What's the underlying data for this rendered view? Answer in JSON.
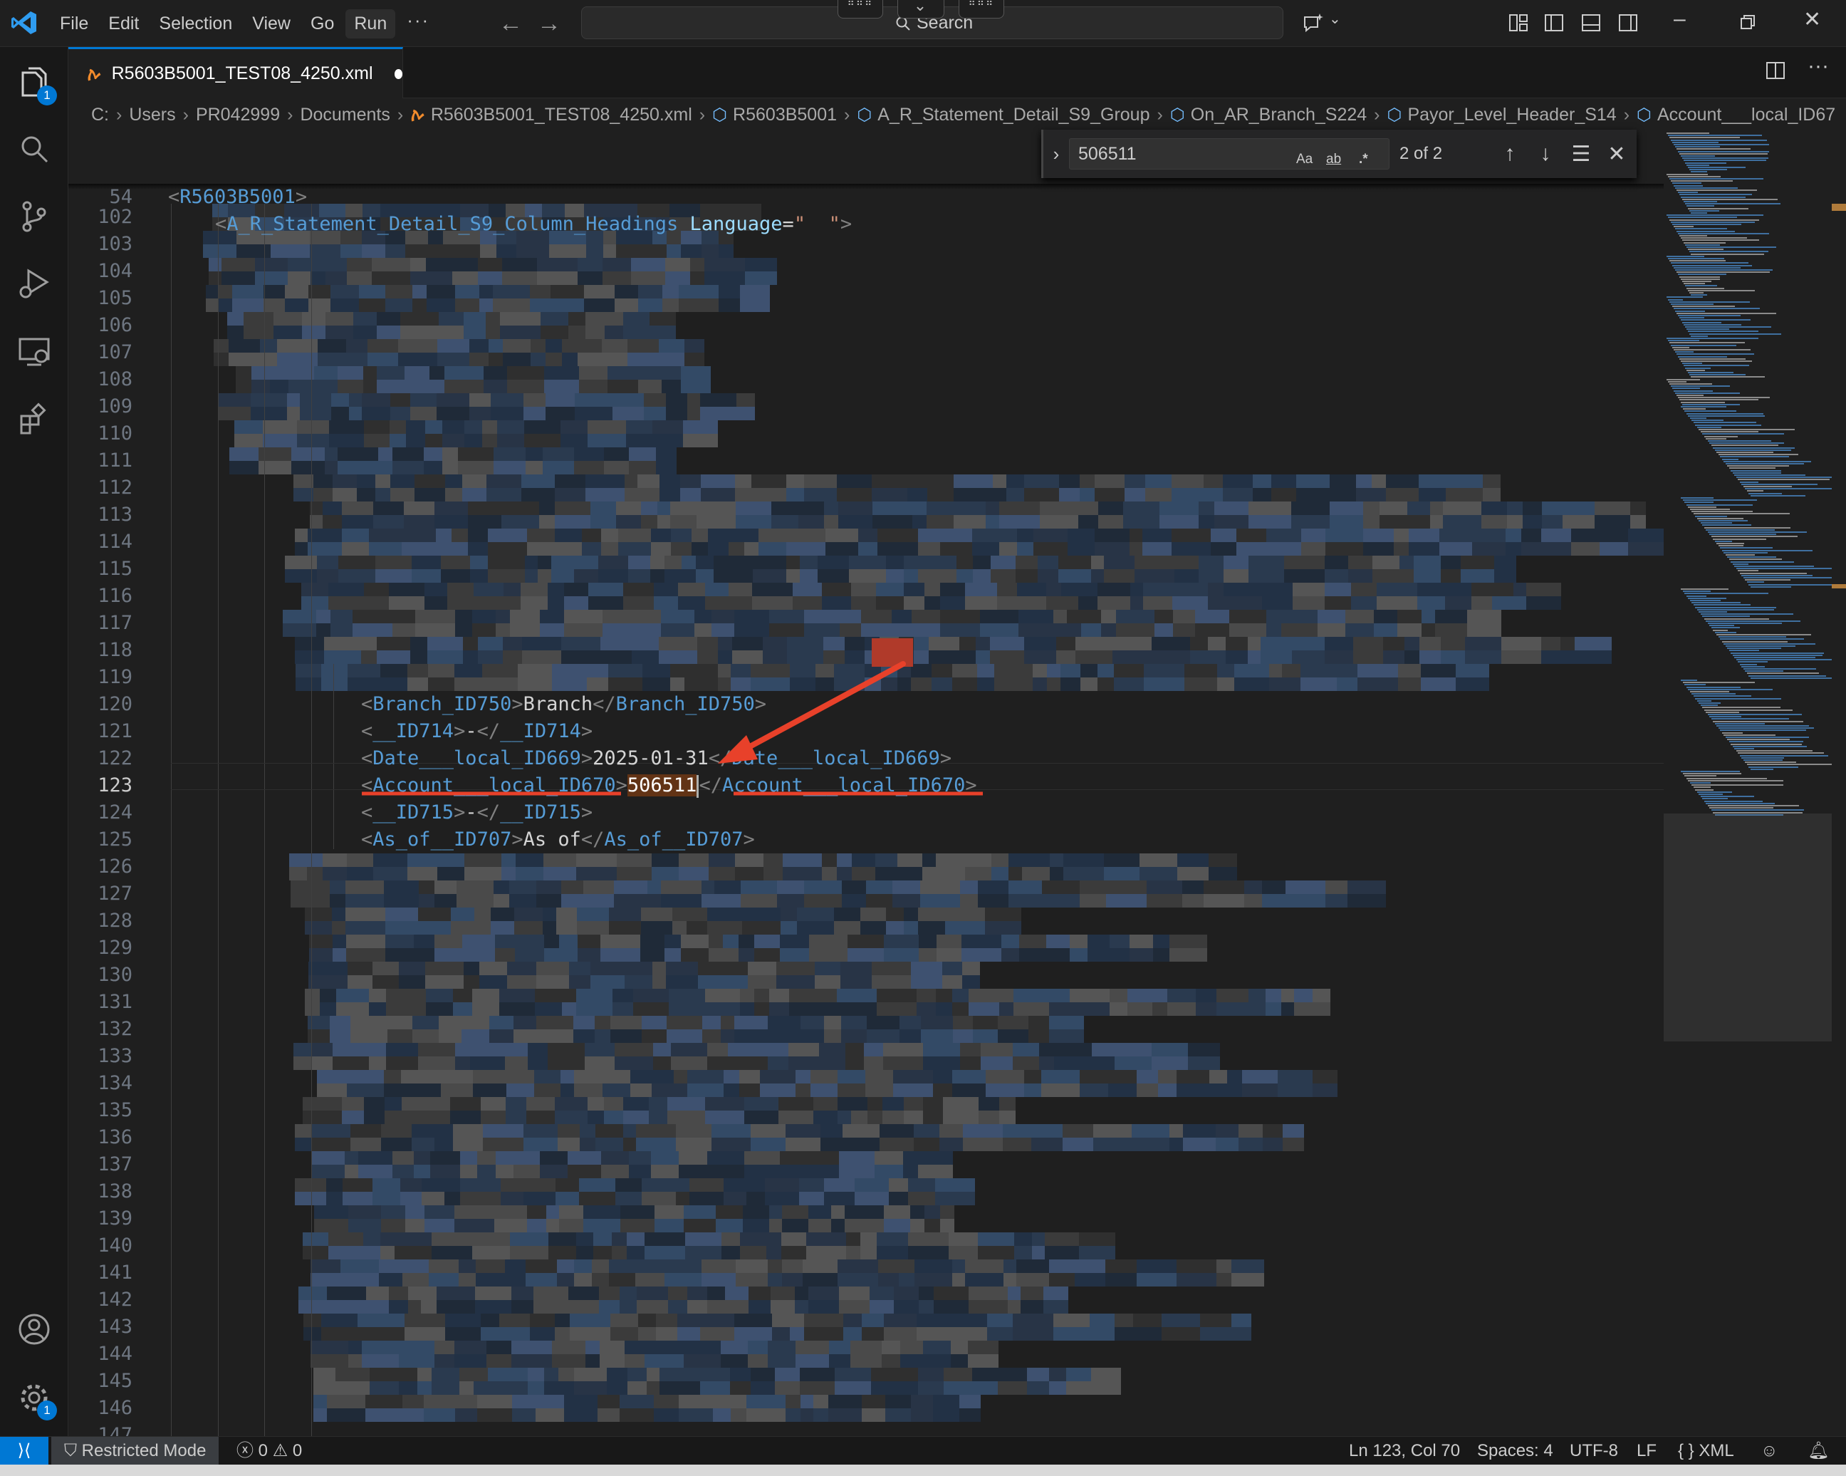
{
  "titlebar": {
    "menus": [
      "File",
      "Edit",
      "Selection",
      "View",
      "Go",
      "Run"
    ],
    "active_menu": "Run",
    "more": "···",
    "search_placeholder": "Search"
  },
  "activity": {
    "explorer_badge": "1",
    "settings_badge": "1"
  },
  "tab": {
    "label": "R5603B5001_TEST08_4250.xml"
  },
  "breadcrumb": [
    "C:",
    "Users",
    "PR042999",
    "Documents",
    "R5603B5001_TEST08_4250.xml",
    "R5603B5001",
    "A_R_Statement_Detail_S9_Group",
    "On_AR_Branch_S224",
    "Payor_Level_Header_S14",
    "Account___local_ID67"
  ],
  "sticky": [
    {
      "number": "4",
      "tag": "R5603B5001"
    },
    {
      "number": "54",
      "tag": "A_R_Statement_Detail_S9_Column_Headings",
      "attr": "Language",
      "value": "\"  \""
    }
  ],
  "find": {
    "query": "506511",
    "count": "2 of 2",
    "opt_case": "Aa",
    "opt_word": "ab",
    "opt_regex": ".*"
  },
  "editor": {
    "line_start": 102,
    "line_end": 147,
    "current_line": 123,
    "visible_lines": {
      "120": {
        "tag": "Branch_ID750",
        "text": "Branch"
      },
      "121": {
        "tag": "__ID714",
        "text": "-"
      },
      "122": {
        "tag": "Date___local_ID669",
        "text": "2025-01-31"
      },
      "123": {
        "tag": "Account___local_ID670",
        "text": "506511"
      },
      "124": {
        "tag": "__ID715",
        "text": "-"
      },
      "125": {
        "tag": "As_of__ID707",
        "text": "As of"
      }
    }
  },
  "statusbar": {
    "restricted": "Restricted Mode",
    "errors": "0",
    "warnings": "0",
    "position": "Ln 123, Col 70",
    "spaces": "Spaces: 4",
    "encoding": "UTF-8",
    "eol": "LF",
    "language": "XML"
  },
  "colors": {
    "accent": "#0078d4",
    "tag": "#569cd6",
    "match": "#623315",
    "annotation": "#e8412a"
  }
}
